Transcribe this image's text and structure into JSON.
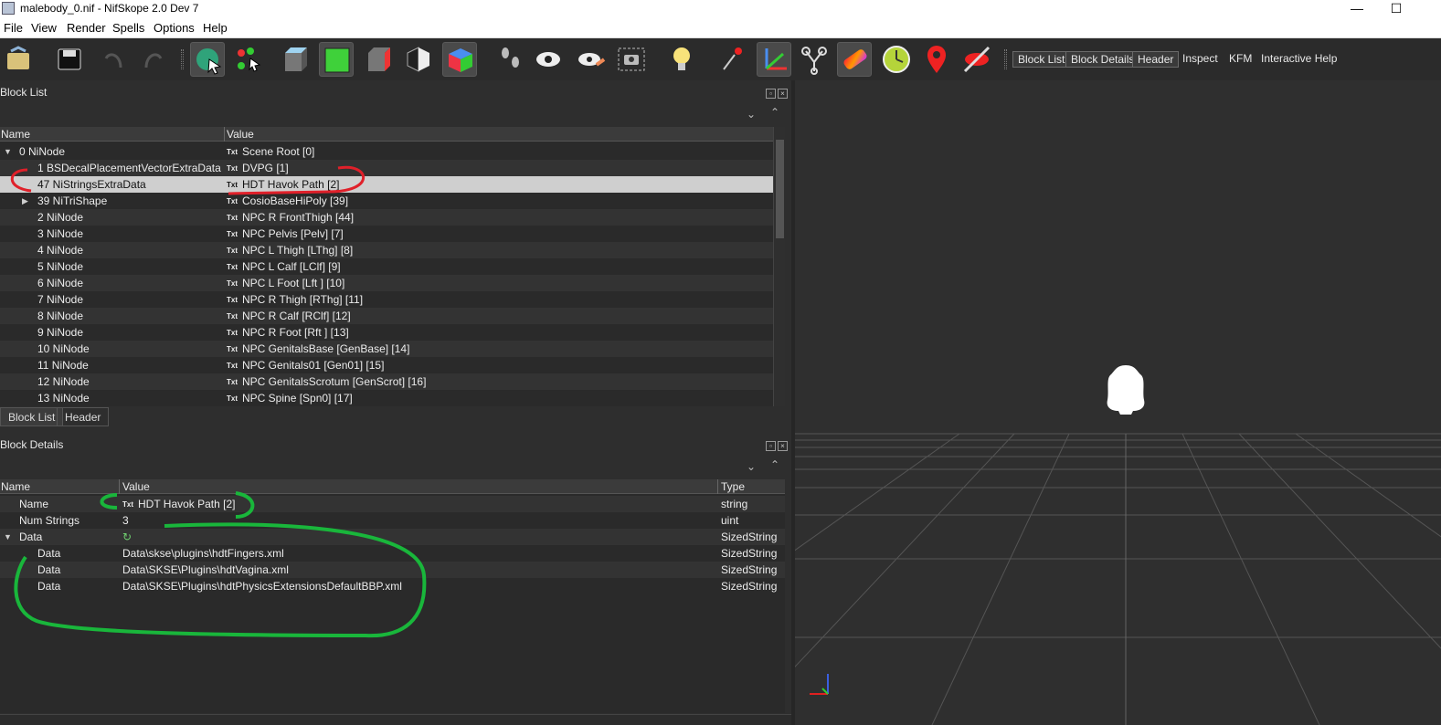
{
  "window": {
    "title": "malebody_0.nif - NifSkope 2.0 Dev 7",
    "minimize": "—",
    "maximize": "☐"
  },
  "menu": [
    "File",
    "View",
    "Render",
    "Spells",
    "Options",
    "Help"
  ],
  "toolbar": {
    "links": [
      "Block List",
      "Block Details",
      "Header",
      "Inspect",
      "KFM",
      "Interactive Help"
    ]
  },
  "block_list": {
    "title": "Block List",
    "columns": {
      "name": "Name",
      "value": "Value"
    },
    "txt_icon": "Txt",
    "rows": [
      {
        "name": "0 NiNode",
        "value": "Scene Root [0]"
      },
      {
        "name": "1 BSDecalPlacementVectorExtraData",
        "value": "DVPG [1]"
      },
      {
        "name": "47 NiStringsExtraData",
        "value": "HDT Havok Path [2]"
      },
      {
        "name": "39 NiTriShape",
        "value": "CosioBaseHiPoly [39]"
      },
      {
        "name": "2 NiNode",
        "value": "NPC R FrontThigh [44]"
      },
      {
        "name": "3 NiNode",
        "value": "NPC Pelvis [Pelv] [7]"
      },
      {
        "name": "4 NiNode",
        "value": "NPC L Thigh [LThg] [8]"
      },
      {
        "name": "5 NiNode",
        "value": "NPC L Calf [LClf] [9]"
      },
      {
        "name": "6 NiNode",
        "value": "NPC L Foot [Lft ] [10]"
      },
      {
        "name": "7 NiNode",
        "value": "NPC R Thigh [RThg] [11]"
      },
      {
        "name": "8 NiNode",
        "value": "NPC R Calf [RClf] [12]"
      },
      {
        "name": "9 NiNode",
        "value": "NPC R Foot [Rft ] [13]"
      },
      {
        "name": "10 NiNode",
        "value": "NPC GenitalsBase [GenBase] [14]"
      },
      {
        "name": "11 NiNode",
        "value": "NPC Genitals01 [Gen01] [15]"
      },
      {
        "name": "12 NiNode",
        "value": "NPC GenitalsScrotum [GenScrot] [16]"
      },
      {
        "name": "13 NiNode",
        "value": "NPC Spine [Spn0] [17]"
      }
    ]
  },
  "bottom_tabs": [
    "Block List",
    "Header"
  ],
  "block_details": {
    "title": "Block Details",
    "columns": {
      "name": "Name",
      "value": "Value",
      "type": "Type"
    },
    "rows": [
      {
        "name": "Name",
        "value": "HDT Havok Path [2]",
        "type": "string"
      },
      {
        "name": "Num Strings",
        "value": "3",
        "type": "uint"
      },
      {
        "name": "Data",
        "value": "",
        "type": "SizedString"
      },
      {
        "name": "Data",
        "value": "Data\\skse\\plugins\\hdtFingers.xml",
        "type": "SizedString"
      },
      {
        "name": "Data",
        "value": "Data\\SKSE\\Plugins\\hdtVagina.xml",
        "type": "SizedString"
      },
      {
        "name": "Data",
        "value": "Data\\SKSE\\Plugins\\hdtPhysicsExtensionsDefaultBBP.xml",
        "type": "SizedString"
      }
    ]
  }
}
